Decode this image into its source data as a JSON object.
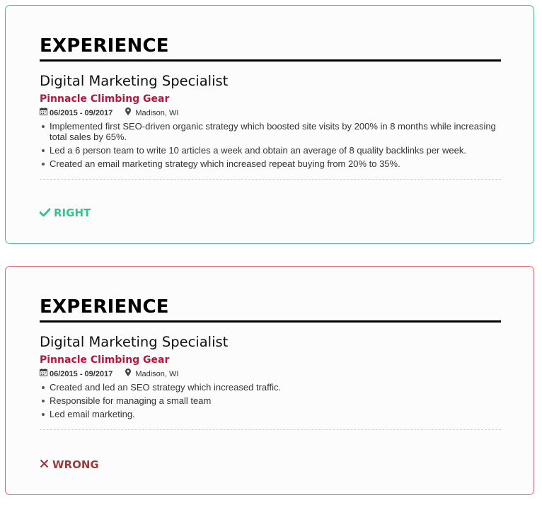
{
  "right_example": {
    "section_title": "EXPERIENCE",
    "job_title": "Digital Marketing Specialist",
    "company": "Pinnacle Climbing Gear",
    "dates": "06/2015 - 09/2017",
    "location": "Madison, WI",
    "bullets": [
      "Implemented first SEO-driven organic strategy which boosted site visits by 200% in 8 months while increasing total sales by 65%.",
      "Led a 6 person team to write 10 articles a week and obtain an average of 8 quality backlinks per week.",
      "Created an email marketing strategy which increased repeat buying from 20% to 35%."
    ],
    "verdict": "RIGHT",
    "verdict_icon": "check-icon",
    "accent_color": "#3ebf8f"
  },
  "wrong_example": {
    "section_title": "EXPERIENCE",
    "job_title": "Digital Marketing Specialist",
    "company": "Pinnacle Climbing Gear",
    "dates": "06/2015 - 09/2017",
    "location": "Madison, WI",
    "bullets": [
      "Created and led an SEO strategy which increased traffic.",
      "Responsible for managing a small team",
      "Led email marketing."
    ],
    "verdict": "WRONG",
    "verdict_icon": "x-icon",
    "accent_color": "#9b3b3f"
  },
  "icons": {
    "dates": "calendar-icon",
    "location": "map-pin-icon"
  },
  "colors": {
    "company": "#b5163b",
    "right_border": "#4bb89a",
    "wrong_border": "#e06470"
  }
}
